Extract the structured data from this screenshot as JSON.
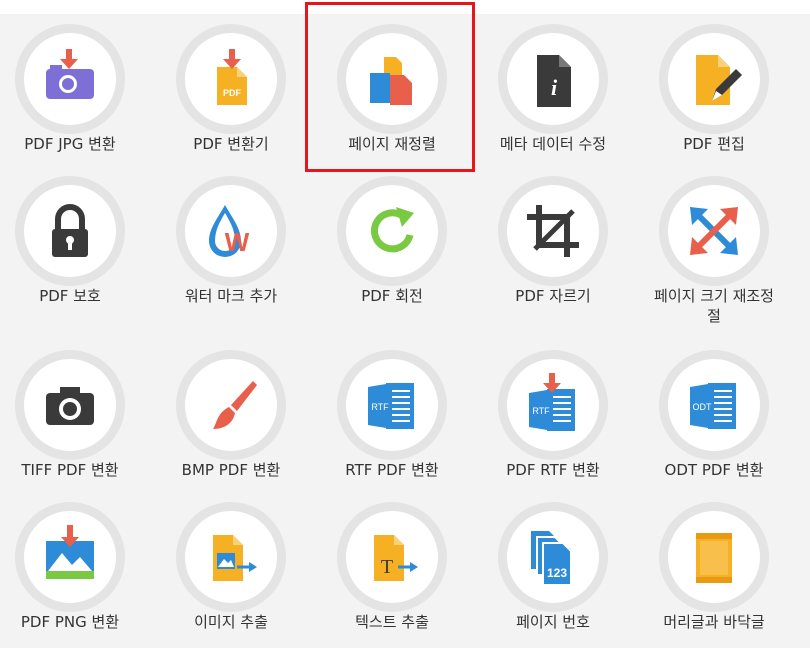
{
  "tools": [
    {
      "label": "PDF JPG 변환",
      "icon": "camera-download-icon"
    },
    {
      "label": "PDF 변환기",
      "icon": "pdf-download-icon"
    },
    {
      "label": "페이지 재정렬",
      "icon": "reorder-pages-icon"
    },
    {
      "label": "메타 데이터 수정",
      "icon": "info-file-icon"
    },
    {
      "label": "PDF 편집",
      "icon": "edit-file-icon"
    },
    {
      "label": "PDF 보호",
      "icon": "lock-icon"
    },
    {
      "label": "워터 마크 추가",
      "icon": "watermark-drop-icon"
    },
    {
      "label": "PDF 회전",
      "icon": "rotate-icon"
    },
    {
      "label": "PDF 자르기",
      "icon": "crop-icon"
    },
    {
      "label": "페이지 크기 재조정",
      "label2": "절",
      "icon": "resize-arrows-icon"
    },
    {
      "label": "TIFF PDF 변환",
      "icon": "camera-icon"
    },
    {
      "label": "BMP PDF 변환",
      "icon": "paintbrush-icon"
    },
    {
      "label": "RTF PDF 변환",
      "icon": "rtf-file-icon"
    },
    {
      "label": "PDF RTF 변환",
      "icon": "rtf-download-icon"
    },
    {
      "label": "ODT PDF 변환",
      "icon": "odt-file-icon"
    },
    {
      "label": "PDF PNG 변환",
      "icon": "image-download-icon"
    },
    {
      "label": "이미지 추출",
      "icon": "extract-image-icon"
    },
    {
      "label": "텍스트 추출",
      "icon": "extract-text-icon"
    },
    {
      "label": "페이지 번호",
      "icon": "page-numbers-icon"
    },
    {
      "label": "머리글과 바닥글",
      "icon": "header-footer-icon"
    }
  ],
  "file_badges": {
    "pdf": "PDF",
    "rtf": "RTF",
    "odt": "ODT",
    "text_glyph": "T",
    "numbers": "123",
    "info_glyph": "i",
    "watermark_glyph": "W"
  },
  "colors": {
    "highlight": "#e8141c",
    "ring": "#e4e4e4",
    "orange": "#f6b023",
    "red": "#e8604c",
    "blue": "#2e8bd8"
  }
}
